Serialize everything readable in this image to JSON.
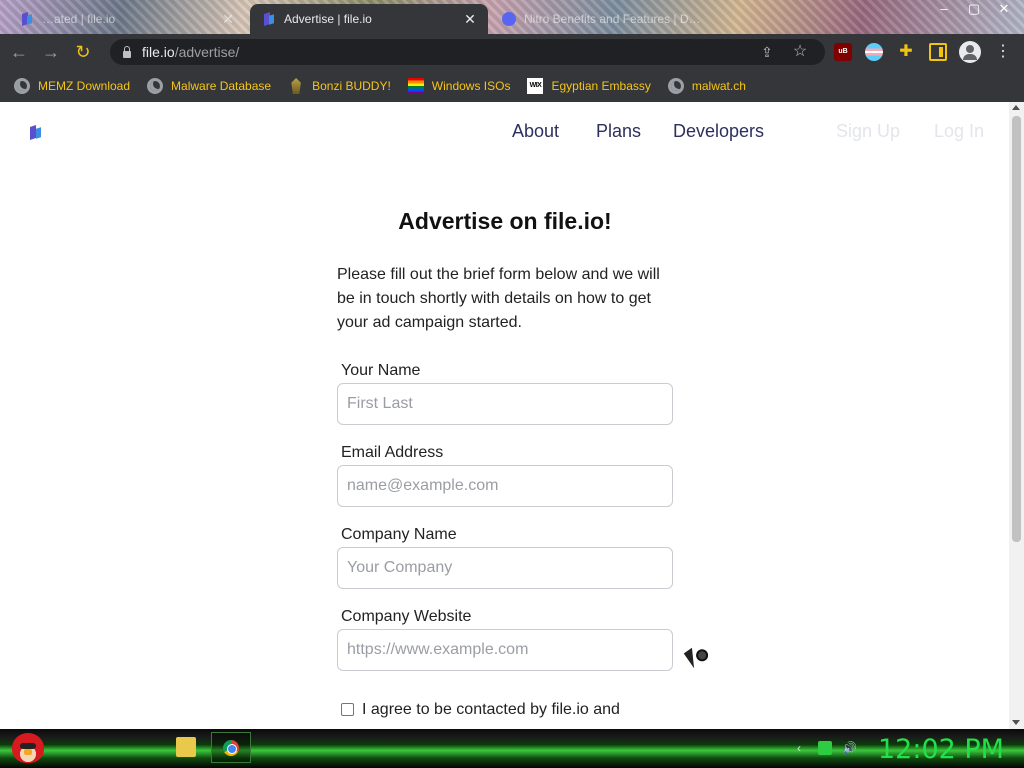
{
  "browser": {
    "tabs": [
      {
        "title": "…ated | file.io",
        "close": "✕"
      },
      {
        "title": "Advertise | file.io",
        "close": "✕"
      },
      {
        "title": "Nitro Benefits and Features | D…",
        "close": "✕"
      }
    ],
    "window_controls": {
      "minimize": "–",
      "maximize": "▢",
      "close": "✕"
    },
    "nav": {
      "back": "←",
      "forward": "→",
      "reload": "↻"
    },
    "url": {
      "host": "file.io",
      "path": "/advertise/"
    },
    "bookmarks": [
      {
        "label": "MEMZ Download",
        "icon": "globe-icon"
      },
      {
        "label": "Malware Database",
        "icon": "globe-icon"
      },
      {
        "label": "Bonzi BUDDY!",
        "icon": "bonzi-icon"
      },
      {
        "label": "Windows ISOs",
        "icon": "rainbow-flag-icon"
      },
      {
        "label": "Egyptian Embassy",
        "icon": "wix-icon"
      },
      {
        "label": "malwat.ch",
        "icon": "globe-icon"
      }
    ],
    "extensions": {
      "ublock": "uB"
    }
  },
  "page": {
    "nav": {
      "about": "About",
      "plans": "Plans",
      "developers": "Developers",
      "signup": "Sign Up",
      "login": "Log In"
    },
    "heading": "Advertise on file.io!",
    "intro": "Please fill out the brief form below and we will be in touch shortly with details on how to get your ad campaign started.",
    "form": {
      "name": {
        "label": "Your Name",
        "placeholder": "First Last"
      },
      "email": {
        "label": "Email Address",
        "placeholder": "name@example.com"
      },
      "company": {
        "label": "Company Name",
        "placeholder": "Your Company"
      },
      "website": {
        "label": "Company Website",
        "placeholder": "https://www.example.com"
      },
      "agree": "I agree to be contacted by file.io and"
    }
  },
  "taskbar": {
    "clock": "12:02 PM",
    "tray_chevron": "‹",
    "volume": "🔊"
  },
  "colors": {
    "accent_green": "#22e04a",
    "bookmark_text": "#f5c518",
    "nav_link": "#2d2f5e"
  }
}
